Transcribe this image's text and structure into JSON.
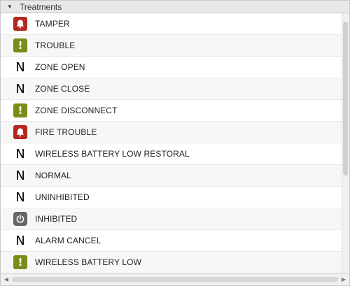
{
  "header": {
    "title": "Treatments"
  },
  "rows": [
    {
      "label": "TAMPER",
      "icon": "alarm-bell-icon"
    },
    {
      "label": "TROUBLE",
      "icon": "trouble-exclamation-icon"
    },
    {
      "label": "ZONE OPEN",
      "icon": "normal-n-icon"
    },
    {
      "label": "ZONE CLOSE",
      "icon": "normal-n-icon"
    },
    {
      "label": "ZONE DISCONNECT",
      "icon": "trouble-exclamation-icon"
    },
    {
      "label": "FIRE TROUBLE",
      "icon": "alarm-bell-icon"
    },
    {
      "label": "WIRELESS BATTERY LOW RESTORAL",
      "icon": "normal-n-icon"
    },
    {
      "label": "NORMAL",
      "icon": "normal-n-icon"
    },
    {
      "label": "UNINHIBITED",
      "icon": "normal-n-icon"
    },
    {
      "label": "INHIBITED",
      "icon": "power-icon"
    },
    {
      "label": "ALARM CANCEL",
      "icon": "normal-n-icon"
    },
    {
      "label": "WIRELESS BATTERY LOW",
      "icon": "trouble-exclamation-icon"
    }
  ],
  "icons": {
    "normal_glyph": "N",
    "trouble_glyph": "!"
  }
}
